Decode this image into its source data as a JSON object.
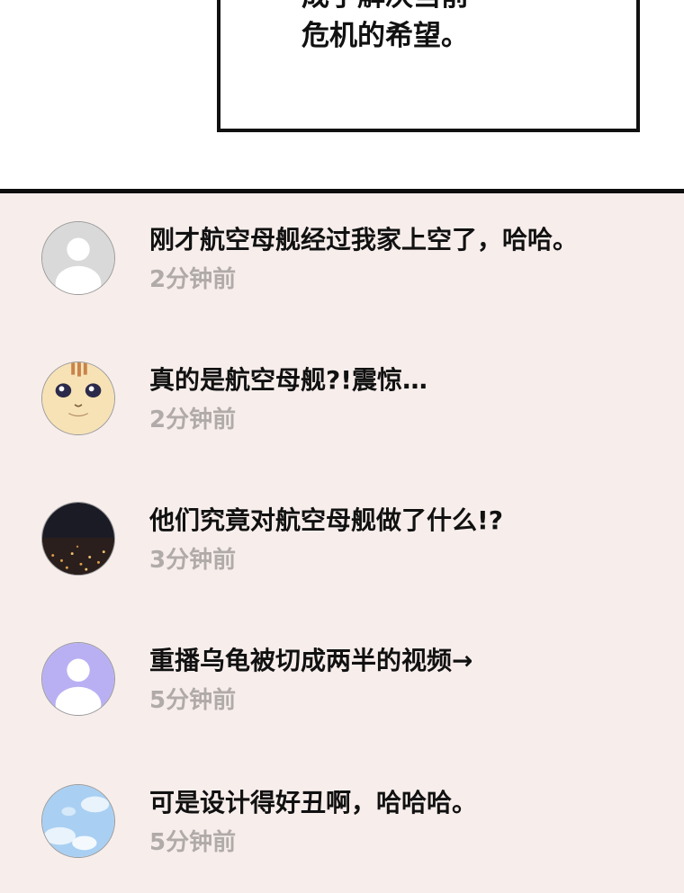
{
  "speech_bubble": {
    "line1": "成了解决当前",
    "line2": "危机的希望。"
  },
  "comments": [
    {
      "avatar_icon": "default-user-avatar-icon",
      "avatar_color": "#d9d9d9",
      "text": "刚才航空母舰经过我家上空了，哈哈。",
      "time": "2分钟前"
    },
    {
      "avatar_icon": "cat-avatar-icon",
      "avatar_color": "#f7e2b5",
      "text": "真的是航空母舰?!震惊…",
      "time": "2分钟前"
    },
    {
      "avatar_icon": "night-city-avatar-icon",
      "avatar_color": "#1b1b26",
      "text": "他们究竟对航空母舰做了什么!?",
      "time": "3分钟前"
    },
    {
      "avatar_icon": "default-user-avatar-icon",
      "avatar_color": "#b9b0f4",
      "text": "重播乌龟被切成两半的视频→",
      "time": "5分钟前"
    },
    {
      "avatar_icon": "sky-clouds-avatar-icon",
      "avatar_color": "#a9d0f3",
      "text": "可是设计得好丑啊，哈哈哈。",
      "time": "5分钟前"
    }
  ]
}
